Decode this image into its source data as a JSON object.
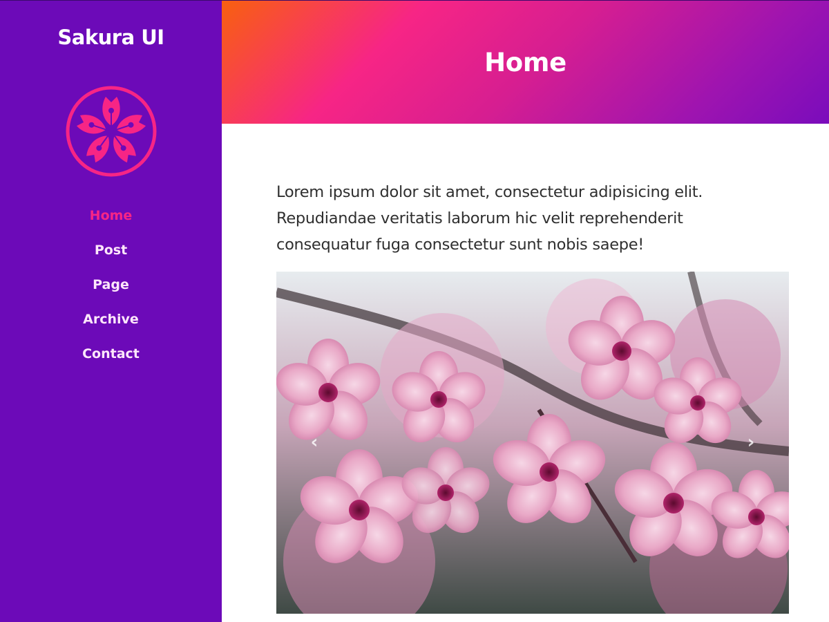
{
  "sidebar": {
    "brand": "Sakura UI",
    "logo_icon": "sakura-flower-icon",
    "nav": [
      {
        "label": "Home",
        "active": true
      },
      {
        "label": "Post",
        "active": false
      },
      {
        "label": "Page",
        "active": false
      },
      {
        "label": "Archive",
        "active": false
      },
      {
        "label": "Contact",
        "active": false
      }
    ]
  },
  "header": {
    "title": "Home"
  },
  "main": {
    "intro": "Lorem ipsum dolor sit amet, consectetur adipisicing elit. Repudiandae veritatis laborum hic velit reprehenderit consequatur fuga consectetur sunt nobis saepe!",
    "carousel": {
      "image_subject": "cherry-blossom-photo",
      "prev_icon": "chevron-left-icon",
      "next_icon": "chevron-right-icon",
      "prev_glyph": "‹",
      "next_glyph": "›"
    }
  },
  "colors": {
    "sidebar_bg": "#6c0ab8",
    "accent": "#f72585",
    "nav_text": "#ffe7fb",
    "body_text": "#2f2f2f",
    "header_gradient": [
      "#f8600f",
      "#f72585",
      "#7a0cbc"
    ]
  }
}
